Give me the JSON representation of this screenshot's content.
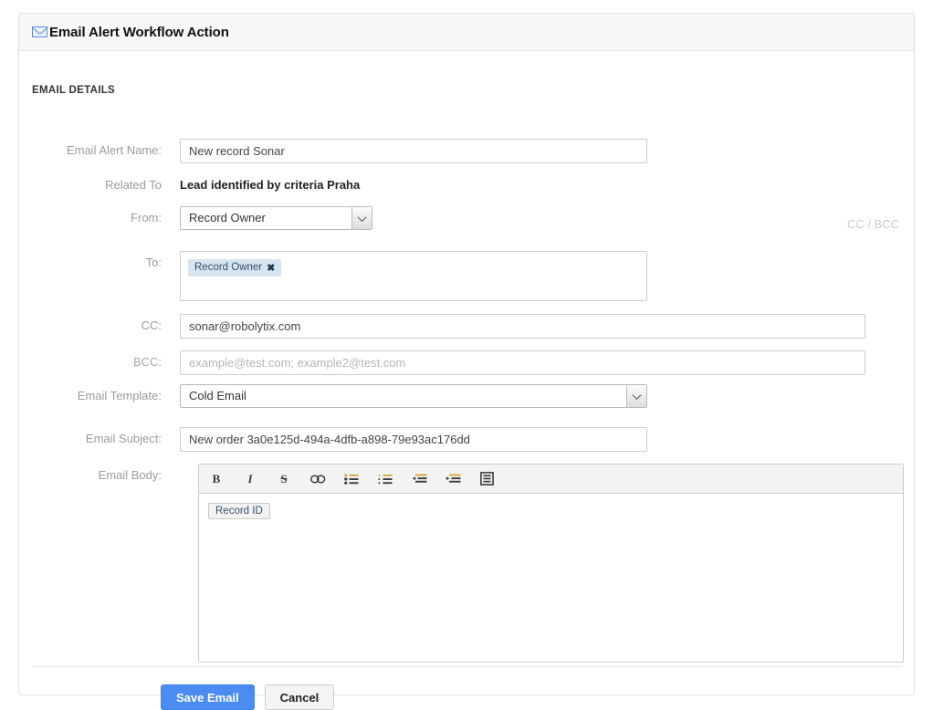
{
  "header": {
    "title": "Email Alert Workflow Action",
    "icon": "envelope-icon"
  },
  "section": {
    "title": "EMAIL DETAILS"
  },
  "form": {
    "email_alert_name": {
      "label": "Email Alert Name:",
      "value": "New record Sonar"
    },
    "related_to": {
      "label": "Related To",
      "value": "Lead identified by criteria Praha"
    },
    "from": {
      "label": "From:",
      "value": "Record Owner"
    },
    "cc_bcc_link": "CC / BCC",
    "to": {
      "label": "To:",
      "tokens": [
        "Record Owner"
      ],
      "remove_glyph": "✖"
    },
    "cc": {
      "label": "CC:",
      "value": "sonar@robolytix.com"
    },
    "bcc": {
      "label": "BCC:",
      "value": "",
      "placeholder": "example@test.com; example2@test.com"
    },
    "email_template": {
      "label": "Email Template:",
      "value": "Cold Email"
    },
    "email_subject": {
      "label": "Email Subject:",
      "value": "New order 3a0e125d-494a-4dfb-a898-79e93ac176dd"
    },
    "email_body": {
      "label": "Email Body:",
      "content_token": "Record ID",
      "toolbar": [
        {
          "name": "bold-icon",
          "label": "B"
        },
        {
          "name": "italic-icon",
          "label": "I"
        },
        {
          "name": "strikethrough-icon",
          "label": "S"
        },
        {
          "name": "link-icon",
          "label": "link"
        },
        {
          "name": "unordered-list-icon",
          "label": "bullets"
        },
        {
          "name": "ordered-list-icon",
          "label": "numbers"
        },
        {
          "name": "outdent-icon",
          "label": "outdent"
        },
        {
          "name": "indent-icon",
          "label": "indent"
        },
        {
          "name": "source-view-icon",
          "label": "source"
        }
      ]
    }
  },
  "footer": {
    "save_label": "Save Email",
    "cancel_label": "Cancel"
  },
  "colors": {
    "primary": "#4a8cf0",
    "header_bg": "#f7f7f7",
    "token_bg": "#d7e5f0",
    "label": "#9b9b9b"
  }
}
